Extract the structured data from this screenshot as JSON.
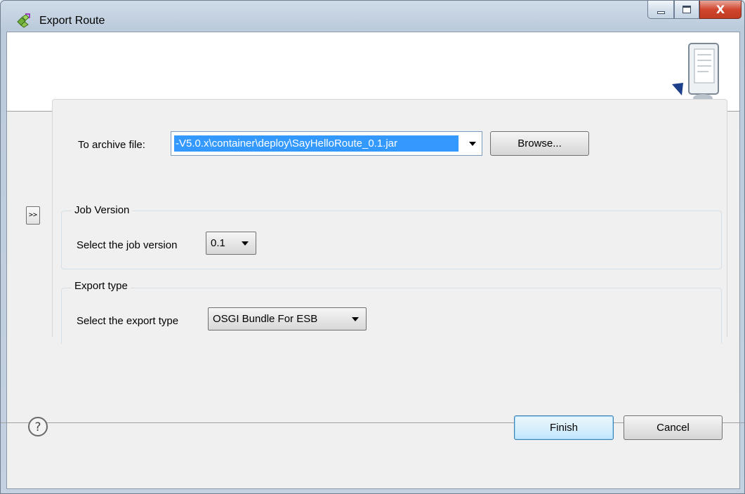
{
  "window": {
    "title": "Export Route",
    "close_glyph": "X"
  },
  "archive": {
    "label": "To archive file:",
    "value": "-V5.0.x\\container\\deploy\\SayHelloRoute_0.1.jar",
    "browse_label": "Browse..."
  },
  "expand_button_label": ">>",
  "job_version": {
    "group_title": "Job Version",
    "label": "Select the job version",
    "selected": "0.1"
  },
  "export_type": {
    "group_title": "Export type",
    "label": "Select the export type",
    "selected": "OSGI Bundle For ESB"
  },
  "footer": {
    "finish_label": "Finish",
    "cancel_label": "Cancel"
  },
  "icons": {
    "app": "export-route-icon",
    "banner": "export-wizard-icon",
    "help": "help-icon"
  },
  "colors": {
    "selection": "#3399ff",
    "close_button": "#c13b23"
  }
}
